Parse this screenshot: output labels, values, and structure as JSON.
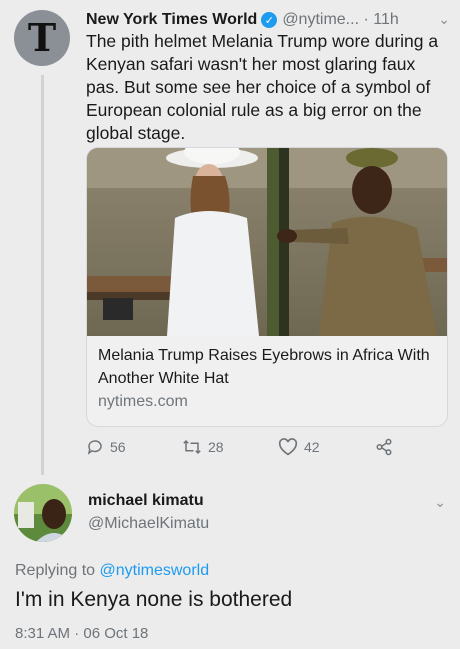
{
  "tweet": {
    "author_name": "New York Times World",
    "author_handle": "@nytime...",
    "time": "11h",
    "text": "The pith helmet Melania Trump wore during a Kenyan safari wasn't her most glaring faux pas. But some see her choice of a symbol of European colonial rule as a big error on the global stage.",
    "card": {
      "title": "Melania Trump Raises Eyebrows in Africa With Another White Hat",
      "domain": "nytimes.com"
    },
    "actions": {
      "replies": "56",
      "retweets": "28",
      "likes": "42"
    }
  },
  "reply": {
    "author_name": "michael kimatu",
    "author_handle": "@MichaelKimatu",
    "replying_prefix": "Replying to",
    "replying_to": "@nytimesworld",
    "text": "I'm in Kenya none is bothered",
    "timestamp": "8:31 AM · 06 Oct 18"
  },
  "colors": {
    "accent": "#1d9bf0",
    "secondary_text": "#6e7479",
    "background": "#ececec"
  },
  "icons": [
    "nyt-logo-icon",
    "verified-badge-icon",
    "chevron-down-icon",
    "reply-icon",
    "retweet-icon",
    "like-icon",
    "share-icon"
  ]
}
